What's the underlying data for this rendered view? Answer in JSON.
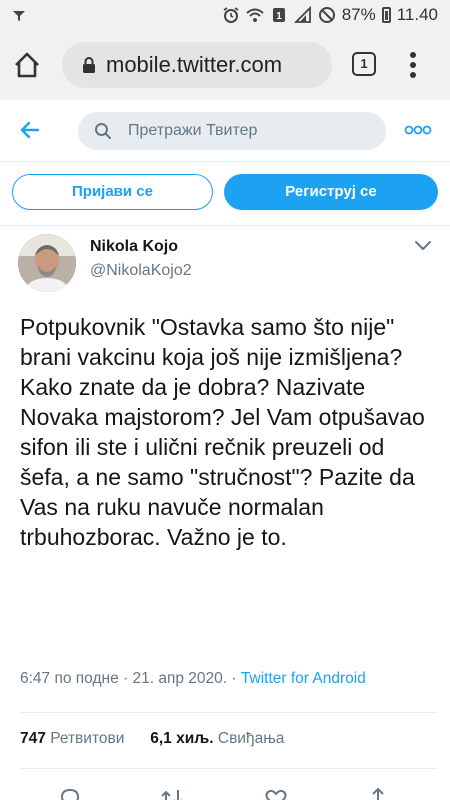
{
  "status_bar": {
    "battery": "87%",
    "time": "11.40",
    "icons": [
      "notification-icon",
      "alarm-icon",
      "wifi-icon",
      "sim-icon",
      "signal-icon",
      "do-not-disturb-icon",
      "battery-icon"
    ]
  },
  "browser": {
    "url": "mobile.twitter.com",
    "tab_count": "1"
  },
  "header": {
    "search_placeholder": "Претражи Твитер"
  },
  "auth": {
    "login_label": "Пријави се",
    "signup_label": "Региструј се"
  },
  "tweet": {
    "author_name": "Nikola Kojo",
    "author_handle": "@NikolaKojo2",
    "text": "Potpukovnik \"Ostavka samo što nije\" brani vakcinu koja još nije izmišljena? Kako znate da je dobra? Nazivate Novaka majstorom? Jel Vam otpušavao sifon ili ste i ulični rečnik preuzeli od šefa, a ne samo \"stručnost\"? Pazite da Vas na ruku navuče normalan trbuhozborac. Važno je to.",
    "time": "6:47 по подне",
    "date": "21. апр 2020.",
    "source": "Twitter for Android",
    "separator": "·",
    "retweets_count": "747",
    "retweets_label": "Ретвитови",
    "likes_count": "6,1 хиљ.",
    "likes_label": "Свиђања"
  },
  "colors": {
    "accent": "#1da1f2",
    "secondary_text": "#657786",
    "browser_chrome": "#f1f1f1"
  }
}
